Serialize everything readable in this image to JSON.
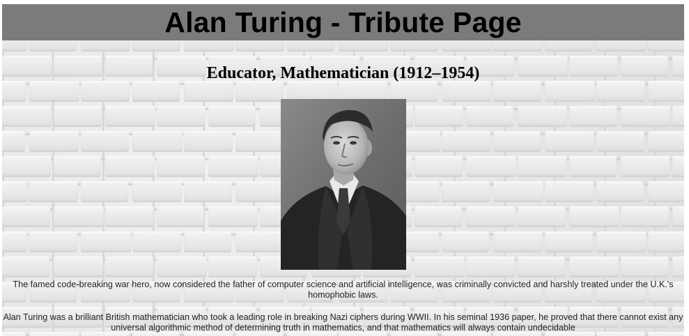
{
  "header": {
    "title": "Alan Turing - Tribute Page"
  },
  "main": {
    "subtitle": "Educator, Mathematician (1912–1954)",
    "image_alt": "Alan Turing portrait photograph",
    "paragraph_1": "The famed code-breaking war hero, now considered the father of computer science and artificial intelligence, was criminally convicted and harshly treated under the U.K.'s homophobic laws.",
    "paragraph_2": "Alan Turing was a brilliant British mathematician who took a leading role in breaking Nazi ciphers during WWII. In his seminal 1936 paper, he proved that there cannot exist any universal algorithmic method of determining truth in mathematics, and that mathematics will always contain undecidable"
  },
  "colors": {
    "header_bg": "#7b7b7b",
    "wall_light": "#eaeaea",
    "mortar": "#c9c9c9"
  }
}
